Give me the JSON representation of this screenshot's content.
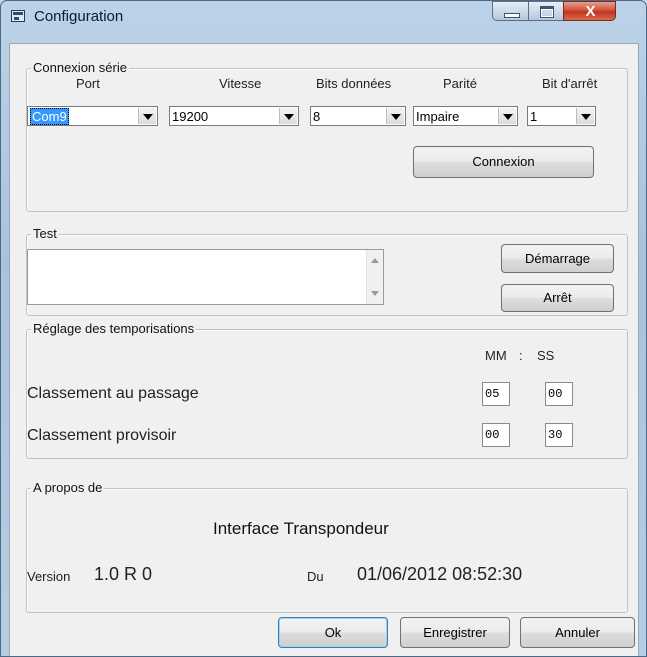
{
  "window": {
    "title": "Configuration",
    "close_glyph": "X"
  },
  "serial": {
    "legend": "Connexion série",
    "headers": {
      "port": "Port",
      "speed": "Vitesse",
      "data_bits": "Bits données",
      "parity": "Parité",
      "stop_bit": "Bit d'arrêt"
    },
    "values": {
      "port": "Com9",
      "speed": "19200",
      "data_bits": "8",
      "parity": "Impaire",
      "stop_bit": "1"
    },
    "connect_button": "Connexion"
  },
  "test": {
    "legend": "Test",
    "memo_text": "",
    "start_button": "Démarrage",
    "stop_button": "Arrêt"
  },
  "timing": {
    "legend": "Réglage des temporisations",
    "col_mm": "MM",
    "col_sep": ":",
    "col_ss": "SS",
    "rows": [
      {
        "label": "Classement au passage",
        "mm": "05",
        "ss": "00"
      },
      {
        "label": "Classement provisoir",
        "mm": "00",
        "ss": "30"
      }
    ]
  },
  "about": {
    "legend": "A propos de",
    "product": "Interface Transpondeur",
    "version_label": "Version",
    "version_value": "1.0 R 0",
    "date_label": "Du",
    "date_value": "01/06/2012 08:52:30"
  },
  "footer": {
    "ok": "Ok",
    "save": "Enregistrer",
    "cancel": "Annuler"
  }
}
